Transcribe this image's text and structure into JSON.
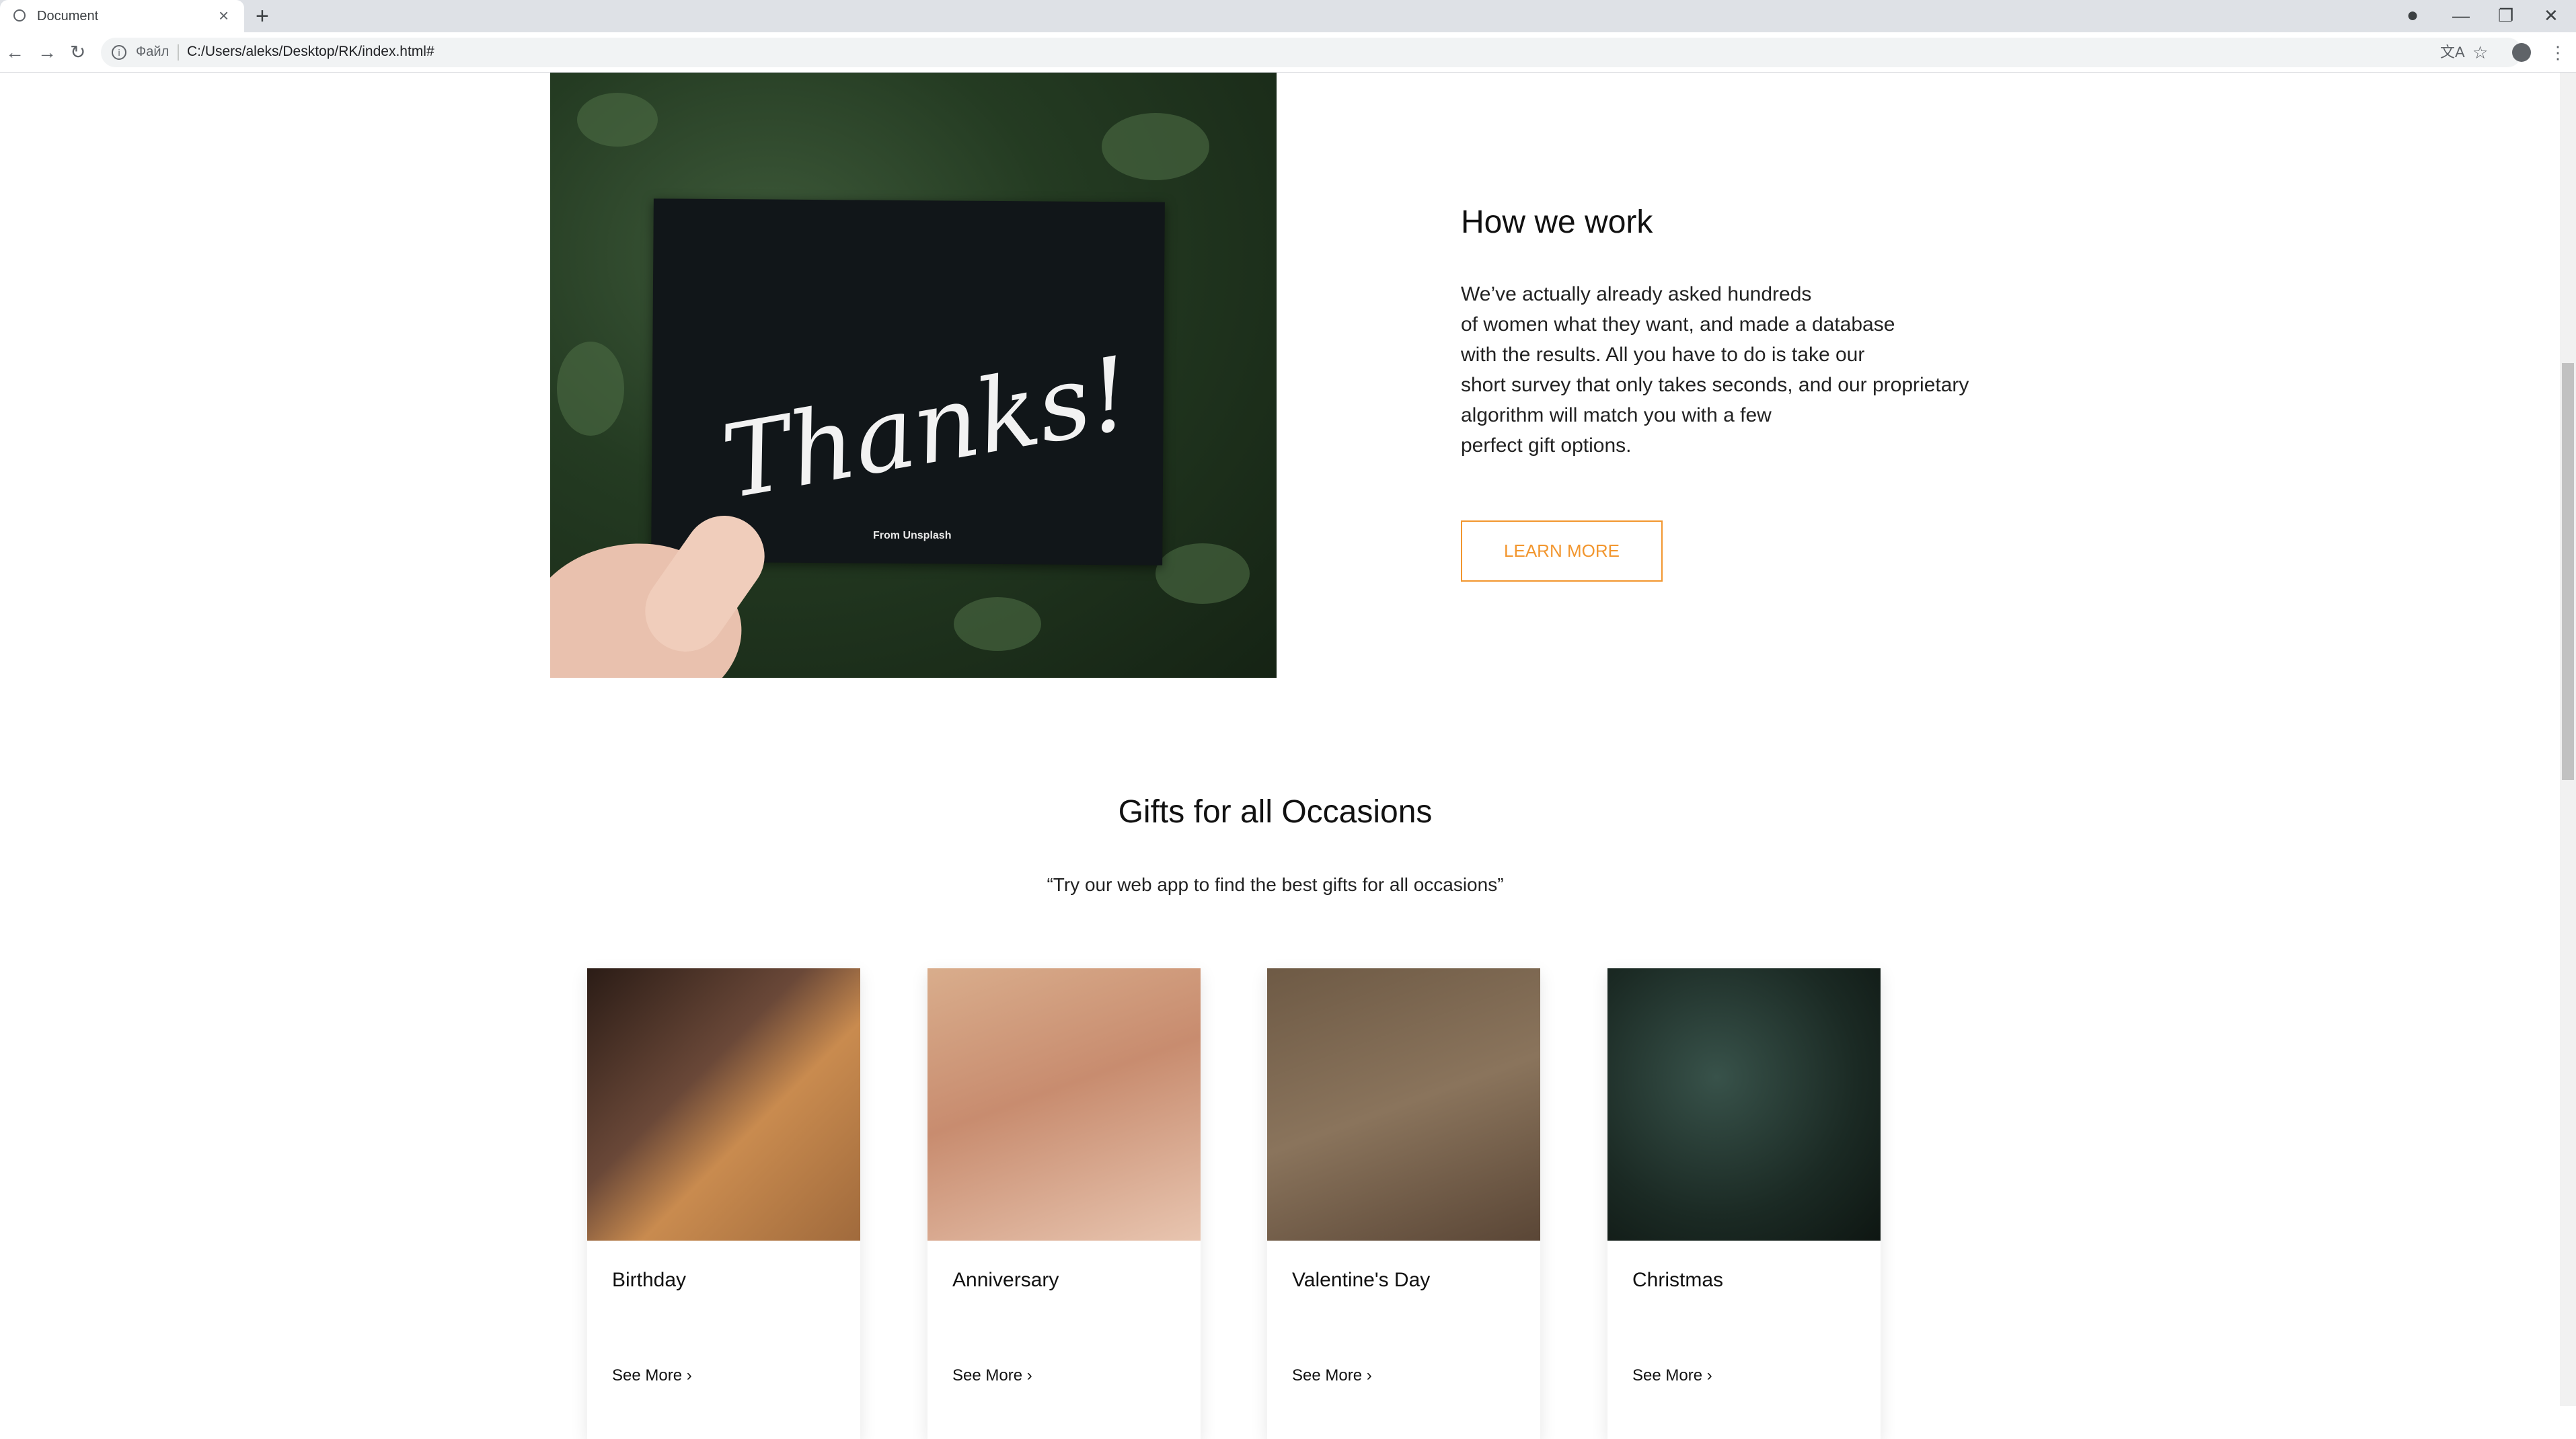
{
  "browser": {
    "tab_title": "Document",
    "new_tab": "+",
    "close_tab": "×",
    "scheme_label": "Файл",
    "url": "C:/Users/aleks/Desktop/RK/index.html#",
    "back": "←",
    "forward": "→",
    "reload": "↻",
    "minimize": "—",
    "restore": "❐",
    "close": "✕",
    "translate_icon": "translate-icon",
    "bookmark": "☆",
    "menu": "⋮"
  },
  "how_we_work": {
    "image_credit": "From Unsplash",
    "card_text": "Thanks!",
    "title": "How we work",
    "body_lines": [
      "We’ve actually already asked hundreds",
      "of women what they want, and made a database",
      "with the results. All you have to do is take our",
      "short survey that only takes seconds, and our proprietary",
      "algorithm will match you with a few",
      "perfect gift options."
    ],
    "button_label": "LEARN MORE",
    "accent_color": "#f2962e"
  },
  "gifts": {
    "title": "Gifts for all Occasions",
    "subtitle": "“Try our web app to find the best gifts for all occasions”",
    "cards": [
      {
        "name": "Birthday",
        "link": "See More ›"
      },
      {
        "name": "Anniversary",
        "link": "See More ›"
      },
      {
        "name": "Valentine's Day",
        "link": "See More ›"
      },
      {
        "name": "Christmas",
        "link": "See More ›"
      }
    ]
  }
}
